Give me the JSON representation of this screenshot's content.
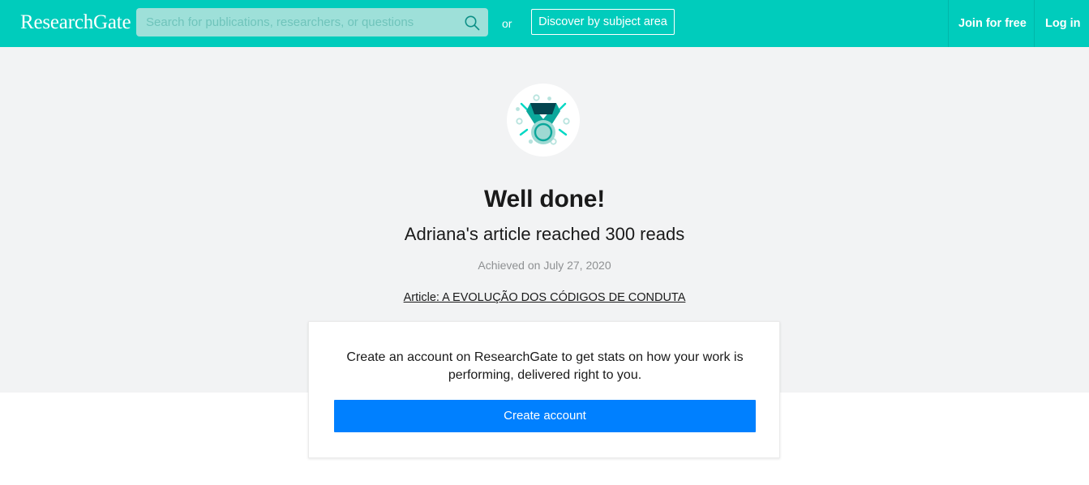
{
  "header": {
    "logo": "ResearchGate",
    "search": {
      "placeholder": "Search for publications, researchers, or questions",
      "value": "",
      "icon": "search-icon"
    },
    "or_label": "or",
    "discover_label": "Discover by subject area",
    "join_label": "Join for free",
    "login_label": "Log in",
    "background_color": "#00ccbc",
    "search_background_color": "#9ee0d9"
  },
  "badge": {
    "icon": "medal-icon",
    "ribbon_color": "#00a99d",
    "ribbon_top_color": "#04454f",
    "medallion_fill": "#9ed9d3",
    "medallion_ring": "#00a99d",
    "spark_color": "#00d8c4",
    "dot_color": "#b8e3de",
    "circle_background": "#ffffff"
  },
  "hero": {
    "title": "Well done!",
    "subtitle": "Adriana's article reached 300 reads",
    "achieved_on": "Achieved on July 27, 2020",
    "article_link": "Article: A EVOLUÇÃO DOS CÓDIGOS DE CONDUTA"
  },
  "card": {
    "message": "Create an account on ResearchGate to get stats on how your work is performing, delivered right to you.",
    "create_account_label": "Create account",
    "button_color": "#0080ff"
  },
  "page": {
    "panel_background": "#f2f3f4",
    "body_background": "#ffffff"
  }
}
